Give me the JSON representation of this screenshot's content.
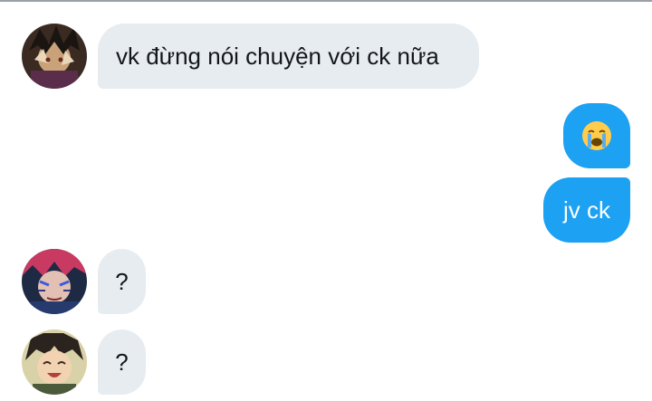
{
  "conversation": {
    "messages": [
      {
        "side": "received",
        "sender_icon": "avatar-dark-hair-icon",
        "text": "vk đừng nói chuyện với ck nữa"
      },
      {
        "side": "sent",
        "emoji_icon": "crying-face-emoji-icon",
        "text": "😭"
      },
      {
        "side": "sent",
        "text": "jv ck"
      },
      {
        "side": "received",
        "sender_icon": "avatar-pink-hair-icon",
        "text": "?"
      },
      {
        "side": "received",
        "sender_icon": "avatar-smiling-boy-icon",
        "text": "?"
      }
    ]
  },
  "colors": {
    "received_bubble": "#e6ecf0",
    "sent_bubble": "#1da1f2",
    "received_text": "#14171a",
    "sent_text": "#ffffff"
  }
}
